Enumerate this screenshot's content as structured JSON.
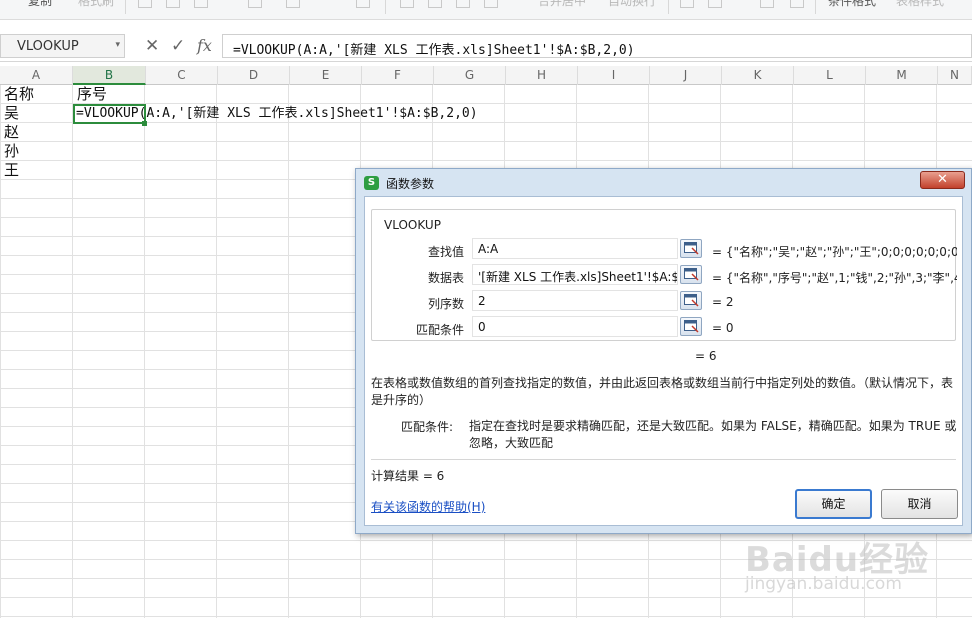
{
  "toolbar": {
    "items": [
      "复制",
      "格式刷",
      "合并居中",
      "自动换行",
      "条件格式",
      "表格样式"
    ]
  },
  "formula_bar": {
    "name_box": "VLOOKUP",
    "cancel_glyph": "✕",
    "confirm_glyph": "✓",
    "fx_label": "fx",
    "formula": "=VLOOKUP(A:A,'[新建 XLS 工作表.xls]Sheet1'!$A:$B,2,0)"
  },
  "sheet": {
    "columns": [
      "A",
      "B",
      "C",
      "D",
      "E",
      "F",
      "G",
      "H",
      "I",
      "J",
      "K",
      "L",
      "M",
      "N"
    ],
    "selected_column": "B",
    "cells": {
      "a1": "名称",
      "b1": "序号",
      "a2": "吴",
      "a3": "赵",
      "a4": "孙",
      "a5": "王",
      "b2": "=VLOOKUP(A:A,'[新建 XLS 工作表.xls]Sheet1'!$A:$B,2,0)"
    }
  },
  "dialog": {
    "title": "函数参数",
    "close_glyph": "✕",
    "function_name": "VLOOKUP",
    "args": [
      {
        "label": "查找值",
        "value": "A:A",
        "result": "= {\"名称\";\"吴\";\"赵\";\"孙\";\"王\";0;0;0;0;0;0;0;0..."
      },
      {
        "label": "数据表",
        "value": "'[新建 XLS 工作表.xls]Sheet1'!$A:$B",
        "result": "= {\"名称\",\"序号\";\"赵\",1;\"钱\",2;\"孙\",3;\"李\",4;..."
      },
      {
        "label": "列序数",
        "value": "2",
        "result": "= 2"
      },
      {
        "label": "匹配条件",
        "value": "0",
        "result": "= 0"
      }
    ],
    "function_result": "= 6",
    "description": "在表格或数值数组的首列查找指定的数值，并由此返回表格或数组当前行中指定列处的数值。（默认情况下，表是升序的）",
    "param_desc_label": "匹配条件:",
    "param_desc": "指定在查找时是要求精确匹配，还是大致匹配。如果为 FALSE，精确匹配。如果为 TRUE 或忽略，大致匹配",
    "calc_result": "计算结果 = 6",
    "help_link": "有关该函数的帮助(H)",
    "ok_label": "确定",
    "cancel_label": "取消"
  },
  "watermark": {
    "main": "Baidu经验",
    "sub": "jingyan.baidu.com"
  },
  "colors": {
    "selection_green": "#2c8c3c",
    "dialog_frame": "#d6e4f2",
    "link_blue": "#1a4fc4",
    "close_red": "#c2412c"
  }
}
